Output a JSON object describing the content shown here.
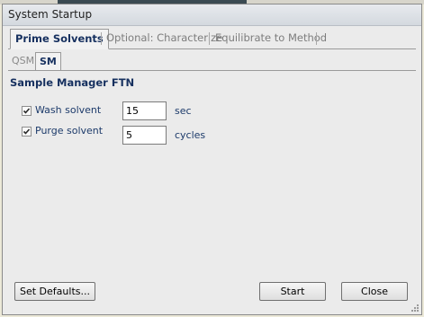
{
  "window": {
    "title": "System Startup"
  },
  "tabs": [
    {
      "label": "Prime Solvents",
      "active": true
    },
    {
      "label": "Optional: Characterize",
      "active": false
    },
    {
      "label": "Equilibrate to Method",
      "active": false
    }
  ],
  "subtabs": [
    {
      "label": "QSM",
      "active": false
    },
    {
      "label": "SM",
      "active": true
    }
  ],
  "section": {
    "title": "Sample Manager FTN"
  },
  "options": [
    {
      "label": "Wash solvent",
      "checked": true,
      "value": "15",
      "unit": "sec"
    },
    {
      "label": "Purge solvent",
      "checked": true,
      "value": "5",
      "unit": "cycles"
    }
  ],
  "buttons": {
    "set_defaults": "Set Defaults...",
    "start": "Start",
    "close": "Close"
  },
  "icons": [
    "checkmark-icon",
    "resize-grip-icon"
  ]
}
